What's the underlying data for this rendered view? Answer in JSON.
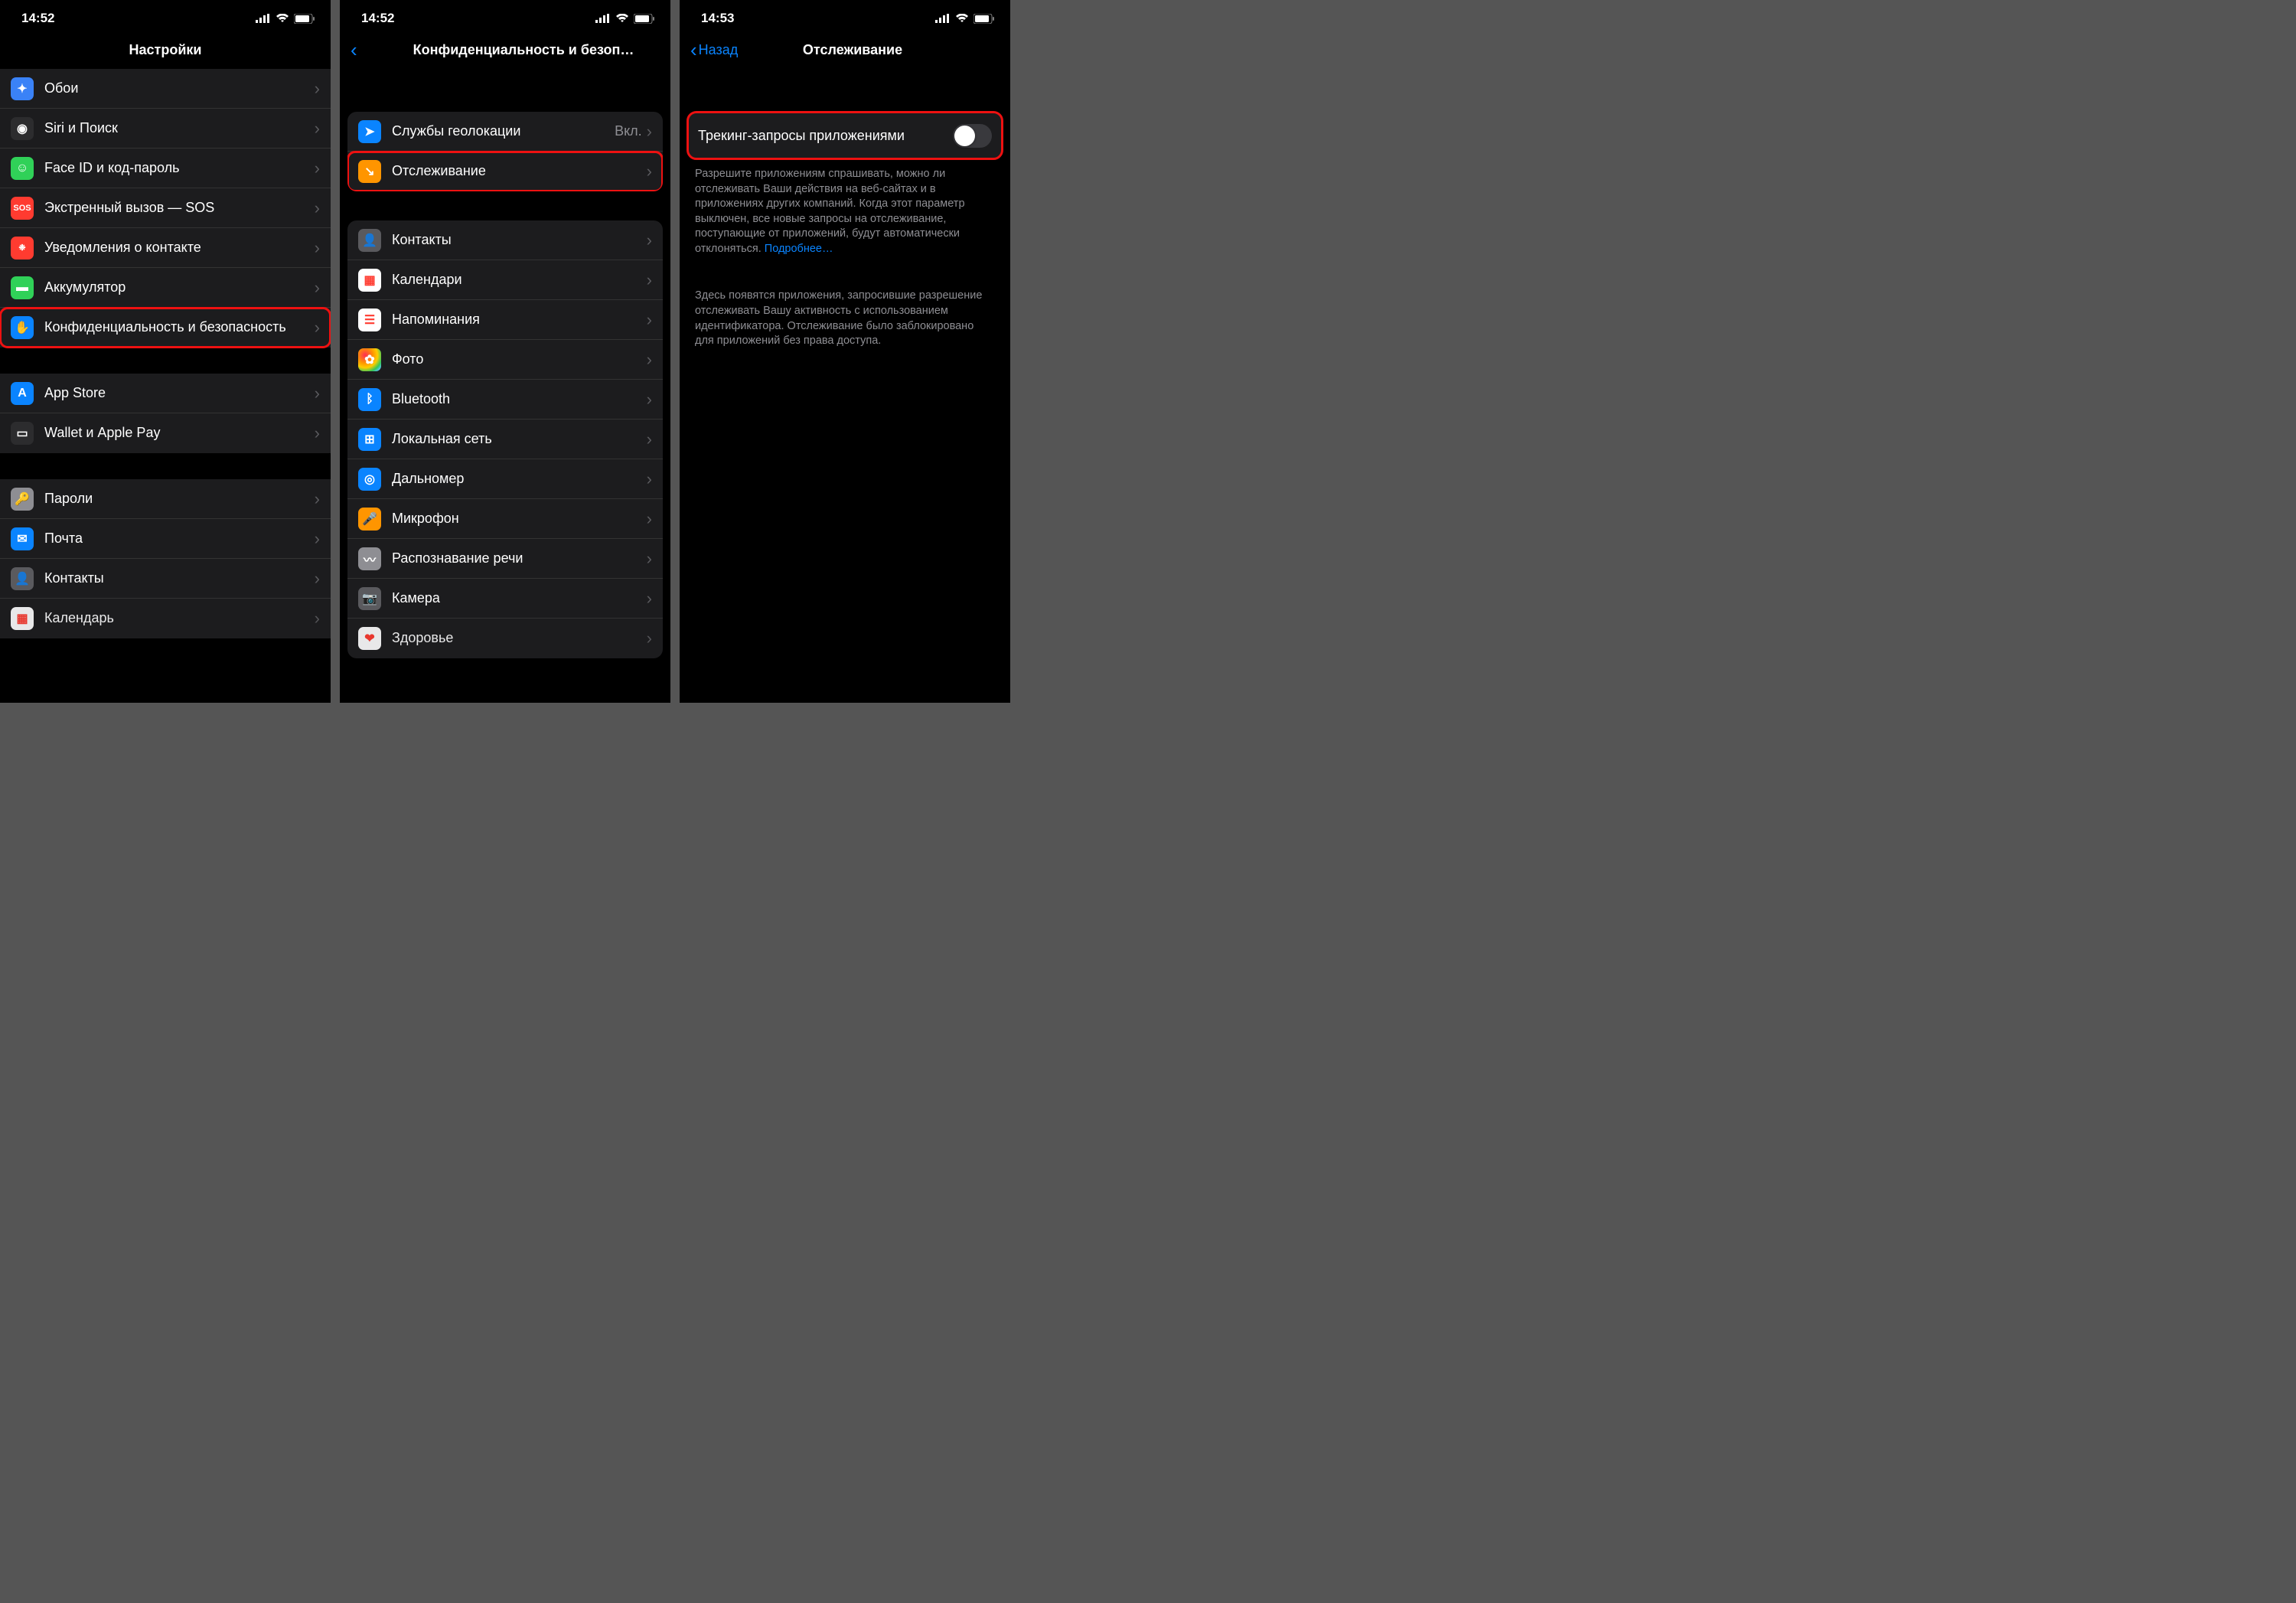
{
  "status": {
    "time1": "14:52",
    "time2": "14:52",
    "time3": "14:53"
  },
  "screen1": {
    "title": "Настройки",
    "groups": [
      [
        {
          "icon": "wallpaper-icon",
          "label": "Обои",
          "color": "ic-lblue",
          "glyph": "✦"
        },
        {
          "icon": "siri-icon",
          "label": "Siri и Поиск",
          "color": "ic-black",
          "glyph": "◉"
        },
        {
          "icon": "faceid-icon",
          "label": "Face ID и код-пароль",
          "color": "ic-green",
          "glyph": "☺"
        },
        {
          "icon": "sos-icon",
          "label": "Экстренный вызов — SOS",
          "color": "ic-red",
          "glyph": "SOS"
        },
        {
          "icon": "exposure-icon",
          "label": "Уведомления о контакте",
          "color": "ic-red",
          "glyph": "❉"
        },
        {
          "icon": "battery-icon",
          "label": "Аккумулятор",
          "color": "ic-green",
          "glyph": "▬"
        },
        {
          "icon": "privacy-icon",
          "label": "Конфиденциальность и безопасность",
          "color": "ic-blue",
          "glyph": "✋",
          "highlight": true
        }
      ],
      [
        {
          "icon": "appstore-icon",
          "label": "App Store",
          "color": "ic-blue",
          "glyph": "A"
        },
        {
          "icon": "wallet-icon",
          "label": "Wallet и Apple Pay",
          "color": "ic-black",
          "glyph": "▭"
        }
      ],
      [
        {
          "icon": "passwords-icon",
          "label": "Пароли",
          "color": "ic-grey",
          "glyph": "🔑"
        },
        {
          "icon": "mail-icon",
          "label": "Почта",
          "color": "ic-blue",
          "glyph": "✉"
        },
        {
          "icon": "contacts-icon",
          "label": "Контакты",
          "color": "ic-dgrey",
          "glyph": "👤"
        },
        {
          "icon": "calendar-icon",
          "label": "Календарь",
          "color": "ic-white",
          "glyph": "▦",
          "partial": true
        }
      ]
    ]
  },
  "screen2": {
    "back": "",
    "title": "Конфиденциальность и безоп…",
    "groups": [
      [
        {
          "icon": "location-icon",
          "label": "Службы геолокации",
          "value": "Вкл.",
          "color": "ic-blue",
          "glyph": "➤"
        },
        {
          "icon": "tracking-icon",
          "label": "Отслеживание",
          "color": "ic-orange",
          "glyph": "↘",
          "highlight": true
        }
      ],
      [
        {
          "icon": "contacts-icon",
          "label": "Контакты",
          "color": "ic-dgrey",
          "glyph": "👤"
        },
        {
          "icon": "calendar-icon",
          "label": "Календари",
          "color": "ic-white",
          "glyph": "▦"
        },
        {
          "icon": "reminders-icon",
          "label": "Напоминания",
          "color": "ic-white",
          "glyph": "☰"
        },
        {
          "icon": "photos-icon",
          "label": "Фото",
          "color": "ic-multi",
          "glyph": "✿"
        },
        {
          "icon": "bluetooth-icon",
          "label": "Bluetooth",
          "color": "ic-blue",
          "glyph": "ᛒ"
        },
        {
          "icon": "localnet-icon",
          "label": "Локальная сеть",
          "color": "ic-blue",
          "glyph": "⊞"
        },
        {
          "icon": "rangefinder-icon",
          "label": "Дальномер",
          "color": "ic-blue",
          "glyph": "◎"
        },
        {
          "icon": "microphone-icon",
          "label": "Микрофон",
          "color": "ic-orange",
          "glyph": "🎤"
        },
        {
          "icon": "speech-icon",
          "label": "Распознавание речи",
          "color": "ic-grey",
          "glyph": "〰"
        },
        {
          "icon": "camera-row-icon",
          "label": "Камера",
          "color": "ic-dgrey",
          "glyph": "📷"
        },
        {
          "icon": "health-icon",
          "label": "Здоровье",
          "color": "ic-white",
          "glyph": "❤",
          "partial": true
        }
      ]
    ]
  },
  "screen3": {
    "back": "Назад",
    "title": "Отслеживание",
    "toggle_label": "Трекинг-запросы приложениями",
    "desc1": "Разрешите приложениям спрашивать, можно ли отслеживать Ваши действия на веб-сайтах и в приложениях других компаний. Когда этот параметр выключен, все новые запросы на отслеживание, поступающие от приложений, будут автоматически отклоняться. ",
    "desc1_link": "Подробнее…",
    "desc2": "Здесь появятся приложения, запросившие разрешение отслеживать Вашу активность с использованием идентификатора. Отслеживание было заблокировано для приложений без права доступа."
  }
}
